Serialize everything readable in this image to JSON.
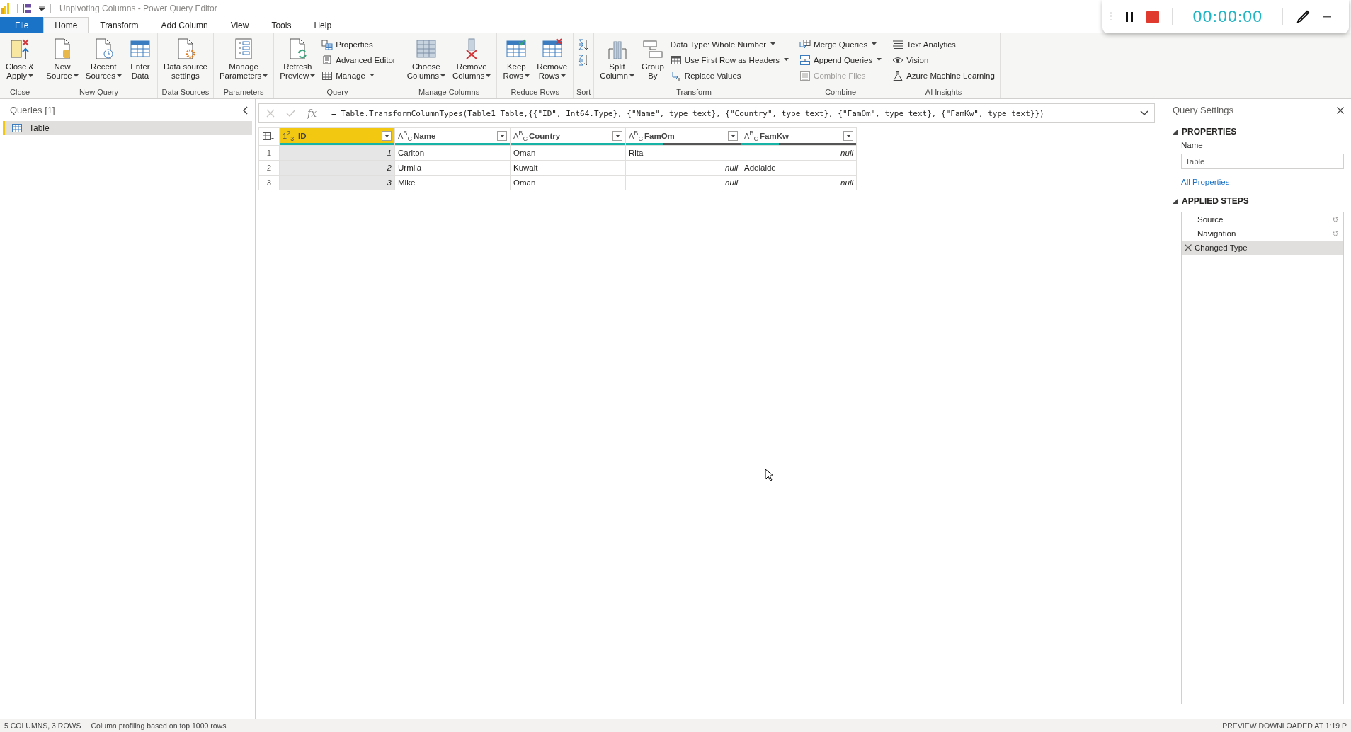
{
  "window": {
    "title": "Unpivoting Columns - Power Query Editor"
  },
  "ribbon_tabs": [
    {
      "label": "File",
      "kind": "file",
      "selected": false
    },
    {
      "label": "Home",
      "kind": "tab",
      "selected": true
    },
    {
      "label": "Transform",
      "kind": "tab",
      "selected": false
    },
    {
      "label": "Add Column",
      "kind": "tab",
      "selected": false
    },
    {
      "label": "View",
      "kind": "tab",
      "selected": false
    },
    {
      "label": "Tools",
      "kind": "tab",
      "selected": false
    },
    {
      "label": "Help",
      "kind": "tab",
      "selected": false
    }
  ],
  "ribbon_groups": [
    {
      "label": "Close",
      "items": [
        {
          "kind": "large",
          "lines": [
            "Close &",
            "Apply"
          ],
          "dropdown": true
        }
      ]
    },
    {
      "label": "New Query",
      "items": [
        {
          "kind": "large",
          "lines": [
            "New",
            "Source"
          ],
          "dropdown": true
        },
        {
          "kind": "large",
          "lines": [
            "Recent",
            "Sources"
          ],
          "dropdown": true
        },
        {
          "kind": "large",
          "lines": [
            "Enter",
            "Data"
          ],
          "dropdown": false
        }
      ]
    },
    {
      "label": "Data Sources",
      "items": [
        {
          "kind": "large",
          "lines": [
            "Data source",
            "settings"
          ],
          "dropdown": false
        }
      ]
    },
    {
      "label": "Parameters",
      "items": [
        {
          "kind": "large",
          "lines": [
            "Manage",
            "Parameters"
          ],
          "dropdown": true
        }
      ]
    },
    {
      "label": "Query",
      "items": [
        {
          "kind": "large",
          "lines": [
            "Refresh",
            "Preview"
          ],
          "dropdown": true
        },
        {
          "kind": "stack",
          "items": [
            {
              "label": "Properties",
              "dropdown": false,
              "disabled": false
            },
            {
              "label": "Advanced Editor",
              "dropdown": false,
              "disabled": false
            },
            {
              "label": "Manage",
              "dropdown": true,
              "disabled": false
            }
          ]
        }
      ]
    },
    {
      "label": "Manage Columns",
      "items": [
        {
          "kind": "large",
          "lines": [
            "Choose",
            "Columns"
          ],
          "dropdown": true
        },
        {
          "kind": "large",
          "lines": [
            "Remove",
            "Columns"
          ],
          "dropdown": true
        }
      ]
    },
    {
      "label": "Reduce Rows",
      "items": [
        {
          "kind": "large",
          "lines": [
            "Keep",
            "Rows"
          ],
          "dropdown": true
        },
        {
          "kind": "large",
          "lines": [
            "Remove",
            "Rows"
          ],
          "dropdown": true
        }
      ]
    },
    {
      "label": "Sort",
      "items": [
        {
          "kind": "sort"
        }
      ]
    },
    {
      "label": "Transform",
      "items": [
        {
          "kind": "large",
          "lines": [
            "Split",
            "Column"
          ],
          "dropdown": true
        },
        {
          "kind": "large",
          "lines": [
            "Group",
            "By"
          ],
          "dropdown": false
        },
        {
          "kind": "stack",
          "items": [
            {
              "label": "Data Type: Whole Number",
              "dropdown": true,
              "disabled": false
            },
            {
              "label": "Use First Row as Headers",
              "dropdown": true,
              "disabled": false
            },
            {
              "label": "Replace Values",
              "dropdown": false,
              "disabled": false
            }
          ]
        }
      ]
    },
    {
      "label": "Combine",
      "items": [
        {
          "kind": "stack",
          "items": [
            {
              "label": "Merge Queries",
              "dropdown": true,
              "disabled": false
            },
            {
              "label": "Append Queries",
              "dropdown": true,
              "disabled": false
            },
            {
              "label": "Combine Files",
              "dropdown": false,
              "disabled": true
            }
          ]
        }
      ]
    },
    {
      "label": "AI Insights",
      "items": [
        {
          "kind": "stack",
          "items": [
            {
              "label": "Text Analytics",
              "dropdown": false,
              "disabled": false
            },
            {
              "label": "Vision",
              "dropdown": false,
              "disabled": false
            },
            {
              "label": "Azure Machine Learning",
              "dropdown": false,
              "disabled": false
            }
          ]
        }
      ]
    }
  ],
  "queries_panel": {
    "title": "Queries [1]",
    "items": [
      {
        "label": "Table",
        "selected": true
      }
    ]
  },
  "formula_bar": {
    "fx": "fx",
    "formula": "= Table.TransformColumnTypes(Table1_Table,{{\"ID\", Int64.Type}, {\"Name\", type text}, {\"Country\", type text}, {\"FamOm\", type text}, {\"FamKw\", type text}})"
  },
  "table": {
    "columns": [
      {
        "type": "1$^{2}$$_{3}$",
        "name": "ID",
        "selected": true,
        "level": 1
      },
      {
        "type": "A$^{B}$$_{C}$",
        "name": "Name",
        "selected": false,
        "level": 1
      },
      {
        "type": "A$^{B}$$_{C}$",
        "name": "Country",
        "selected": false,
        "level": 1
      },
      {
        "type": "A$^{B}$$_{C}$",
        "name": "FamOm",
        "selected": false,
        "level": 0.33
      },
      {
        "type": "A$^{B}$$_{C}$",
        "name": "FamKw",
        "selected": false,
        "level": 0.33
      }
    ],
    "rows": [
      {
        "number": "1",
        "cells": [
          {
            "value": "1",
            "kind": "number"
          },
          {
            "value": "Carlton",
            "kind": "text"
          },
          {
            "value": "Oman",
            "kind": "text"
          },
          {
            "value": "Rita",
            "kind": "text"
          },
          {
            "value": "null",
            "kind": "null"
          }
        ]
      },
      {
        "number": "2",
        "cells": [
          {
            "value": "2",
            "kind": "number"
          },
          {
            "value": "Urmila",
            "kind": "text"
          },
          {
            "value": "Kuwait",
            "kind": "text"
          },
          {
            "value": "null",
            "kind": "null"
          },
          {
            "value": "Adelaide",
            "kind": "text"
          }
        ]
      },
      {
        "number": "3",
        "cells": [
          {
            "value": "3",
            "kind": "number"
          },
          {
            "value": "Mike",
            "kind": "text"
          },
          {
            "value": "Oman",
            "kind": "text"
          },
          {
            "value": "null",
            "kind": "null"
          },
          {
            "value": "null",
            "kind": "null"
          }
        ]
      }
    ]
  },
  "query_settings": {
    "title": "Query Settings",
    "properties_heading": "PROPERTIES",
    "name_label": "Name",
    "name_value": "Table",
    "link": "All Properties",
    "steps_heading": "APPLIED STEPS",
    "steps": [
      {
        "label": "Source",
        "selected": false,
        "settings": true
      },
      {
        "label": "Navigation",
        "selected": false,
        "settings": true
      },
      {
        "label": "Changed Type",
        "selected": true,
        "settings": false
      }
    ]
  },
  "status_bar": {
    "left": [
      "5 COLUMNS, 3 ROWS",
      "Column profiling based on top 1000 rows"
    ],
    "right": "PREVIEW DOWNLOADED AT 1:19 P"
  },
  "recorder": {
    "time": "00:00:00"
  }
}
